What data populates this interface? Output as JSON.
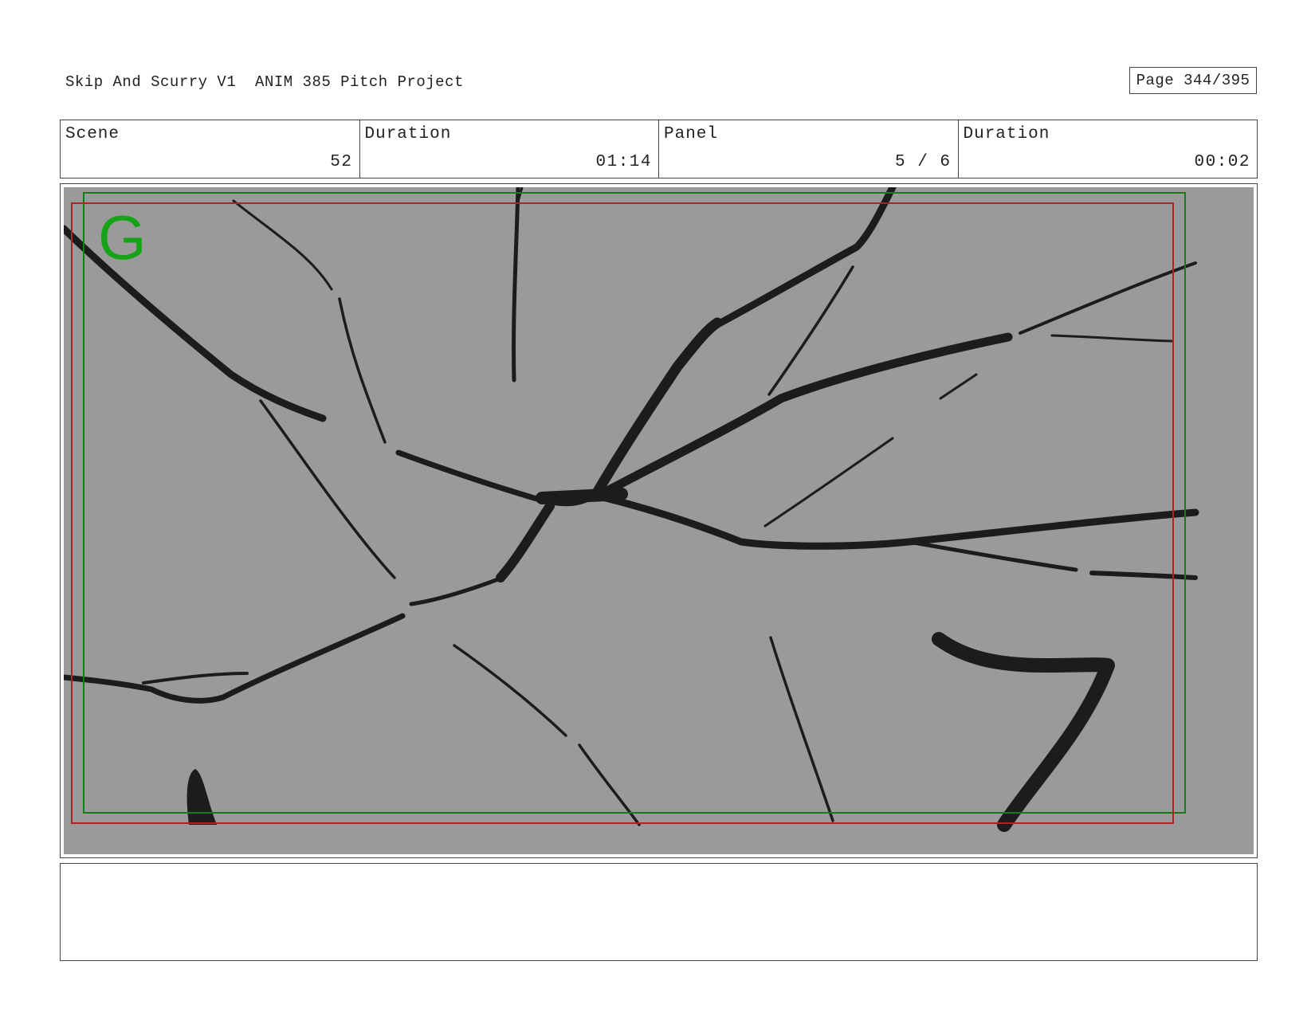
{
  "header": {
    "title": "Skip And Scurry V1  ANIM 385 Pitch Project",
    "page": "Page 344/395"
  },
  "info": {
    "scene_label": "Scene",
    "scene_value": "52",
    "scene_duration_label": "Duration",
    "scene_duration_value": "01:14",
    "panel_label": "Panel",
    "panel_value": "5 / 6",
    "panel_duration_label": "Duration",
    "panel_duration_value": "00:02"
  },
  "panel": {
    "guide_letter": "G",
    "background_color": "#9a9a9a",
    "line_color": "#1c1c1c",
    "safe_frame_outer_color": "#1a7a1a",
    "safe_frame_inner_color": "#b32222",
    "content": "cracked-glass-drawing"
  },
  "notes": {
    "text": ""
  }
}
